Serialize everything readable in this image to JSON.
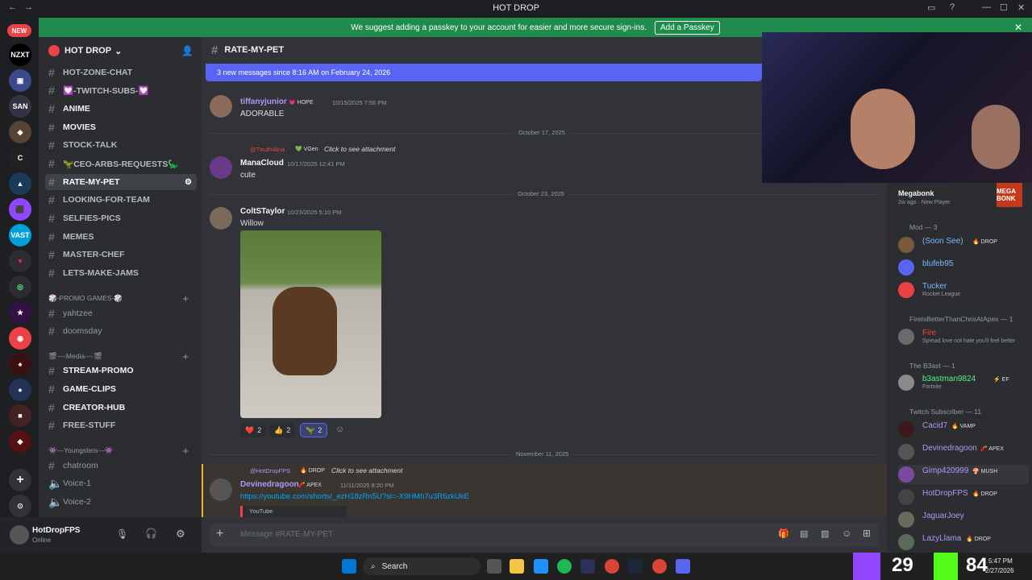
{
  "window": {
    "title": "HOT DROP"
  },
  "server_badge": "NEW",
  "passkey_banner": {
    "text": "We suggest adding a passkey to your account for easier and more secure sign-ins.",
    "button": "Add a Passkey"
  },
  "server": {
    "name": "HOT DROP"
  },
  "channels": [
    {
      "name": "HOT-ZONE-CHAT"
    },
    {
      "name": "💟-TWITCH-SUBS-💟"
    },
    {
      "name": "ANIME"
    },
    {
      "name": "MOVIES"
    },
    {
      "name": "STOCK-TALK"
    },
    {
      "name": "🦖CEO-ARBS-REQUESTS🦕"
    },
    {
      "name": "RATE-MY-PET"
    },
    {
      "name": "LOOKING-FOR-TEAM"
    },
    {
      "name": "SELFIES-PICS"
    },
    {
      "name": "MEMES"
    },
    {
      "name": "MASTER-CHEF"
    },
    {
      "name": "LETS-MAKE-JAMS"
    }
  ],
  "categories": [
    "🎲-PROMO GAMES-🎲",
    "🎬----Media----🎬",
    "👾---Youngsters---👾"
  ],
  "promo_channels": [
    "yahtzee",
    "doomsday"
  ],
  "media_channels": [
    "STREAM-PROMO",
    "GAME-CLIPS",
    "CREATOR-HUB",
    "FREE-STUFF"
  ],
  "youngster_channels": [
    "chatroom",
    "Voice-1",
    "Voice-2"
  ],
  "user": {
    "name": "HotDropFPS",
    "status": "Online"
  },
  "chat": {
    "channel": "RATE-MY-PET",
    "new_messages": "3 new messages since 8:16 AM on February 24, 2026",
    "composer_placeholder": "Message #RATE-MY-PET",
    "messages": [
      {
        "user": "tiffanyjunior",
        "tag": "💗 HOPE",
        "time": "10/15/2025 7:56 PM",
        "text": "ADORABLE"
      },
      {
        "reply_user": "@Ttruth4lina",
        "reply_tag": "💚 VGen",
        "reply_text": "Click to see attachment",
        "user": "ManaCloud",
        "time": "10/17/2025 12:41 PM",
        "text": "cute"
      },
      {
        "user": "ColtSTaylor",
        "time": "10/23/2025 5:10 PM",
        "text": "Willow"
      },
      {
        "reply_user": "@HotDropFPS",
        "reply_tag": "🔥 DROP",
        "reply_text": "Click to see attachment",
        "user": "Devinedragoon",
        "tag": "🧨 APEX",
        "time": "11/11/2025 8:20 PM",
        "text": "https://youtube.com/shorts/_ezH18zRn5U?si=-X9HMh7u3R6zkUkE",
        "embed": "YouTube"
      }
    ],
    "dates": [
      "October 17, 2025",
      "October 23, 2025",
      "November 11, 2025"
    ],
    "reactions": [
      {
        "emoji": "❤️",
        "count": "2"
      },
      {
        "emoji": "👍",
        "count": "2"
      },
      {
        "emoji": "🦖",
        "count": "2"
      }
    ]
  },
  "activity": {
    "game": "Megabonk",
    "sub": "2w ago · New Player"
  },
  "members": {
    "groups": [
      {
        "label": "Mod — 3",
        "list": [
          {
            "name": "(Soon See)",
            "tag": "🔥 DROP",
            "color": "#79b8ff"
          },
          {
            "name": "blufeb95",
            "color": "#79b8ff"
          },
          {
            "name": "Tucker",
            "sub": "Rocket League",
            "color": "#79b8ff"
          }
        ]
      },
      {
        "label": "FireIsBetterThanChrisAtApex — 1",
        "list": [
          {
            "name": "Fire",
            "sub": "Spread love not hate you'll feel better",
            "color": "#ed4245"
          }
        ]
      },
      {
        "label": "The B3ast — 1",
        "list": [
          {
            "name": "b3astman9824",
            "tag": "⚡ EF",
            "sub": "Fortnite",
            "color": "#57f287"
          }
        ]
      },
      {
        "label": "Twitch Subscriber — 11",
        "list": [
          {
            "name": "Cacid7",
            "tag": "🔥 VAMP",
            "color": "#b196f5"
          },
          {
            "name": "Devinedragoon",
            "tag": "🧨 APEX",
            "color": "#b196f5"
          },
          {
            "name": "Gimp420999",
            "tag": "🍄 MUSH",
            "color": "#b196f5"
          },
          {
            "name": "HotDropFPS",
            "tag": "🔥 DROP",
            "color": "#b196f5"
          },
          {
            "name": "JaguarJoey",
            "color": "#b196f5"
          },
          {
            "name": "LazyLlama",
            "tag": "🔥 DROP",
            "color": "#b196f5"
          }
        ]
      }
    ]
  },
  "taskbar": {
    "search": "Search",
    "big_num1": "29",
    "big_num2": "84",
    "time": "5:47 PM",
    "date": "2/27/2026"
  },
  "colors": {
    "accent": "#5865f2",
    "passkey": "#1f8b4c",
    "link": "#00a8fc"
  }
}
